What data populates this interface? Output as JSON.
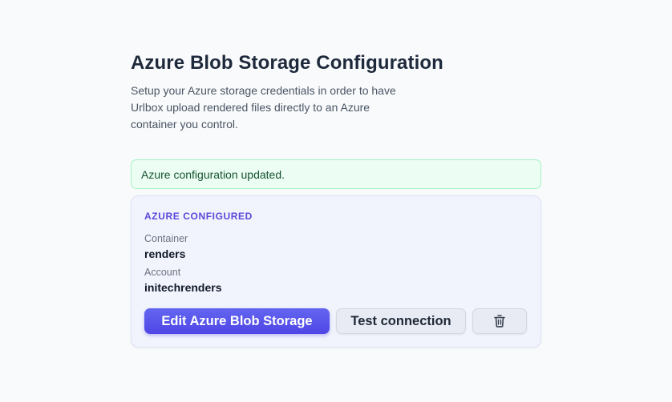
{
  "header": {
    "title": "Azure Blob Storage Configuration",
    "description": "Setup your Azure storage credentials in order to have Urlbox upload rendered files directly to an Azure container you control."
  },
  "alert": {
    "message": "Azure configuration updated.",
    "color": "#ecfdf3"
  },
  "card": {
    "status": "AZURE CONFIGURED",
    "status_color": "#5b48d9",
    "fields": [
      {
        "label": "Container",
        "value": "renders"
      },
      {
        "label": "Account",
        "value": "initechrenders"
      }
    ],
    "actions": {
      "edit_label": "Edit Azure Blob Storage",
      "test_label": "Test connection",
      "delete_icon": "trash-icon"
    }
  },
  "colors": {
    "primary": "#4f46e5",
    "background": "#f8fafc"
  }
}
